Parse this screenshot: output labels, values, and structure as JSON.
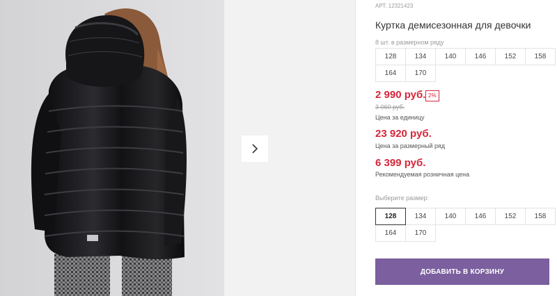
{
  "product": {
    "sku": "АРТ. 12321423",
    "title": "Куртка демисезонная для девочки",
    "row_note": "8 шт. в размерном ряду",
    "row_sizes": [
      "128",
      "134",
      "140",
      "146",
      "152",
      "158",
      "164",
      "170"
    ]
  },
  "pricing": {
    "unit_price": "2 990 руб.",
    "discount": "2%",
    "old_price": "3 060 руб.",
    "unit_caption": "Цена за единицу",
    "row_price": "23 920 руб.",
    "row_caption": "Цена за размерный ряд",
    "rrp_price": "6 399 руб.",
    "rrp_caption": "Рекомендуемая розничная цена"
  },
  "size_picker": {
    "label": "Выберите размер:",
    "sizes": [
      "128",
      "134",
      "140",
      "146",
      "152",
      "158",
      "164",
      "170"
    ],
    "selected": "128"
  },
  "cart": {
    "button_label": "ДОБАВИТЬ В КОРЗИНУ"
  },
  "gallery": {
    "next_icon": "chevron-right-icon"
  },
  "colors": {
    "price": "#d6263a",
    "accent": "#7b5f9e",
    "photo_bg": "#dcdcde",
    "jacket": "#141416"
  }
}
